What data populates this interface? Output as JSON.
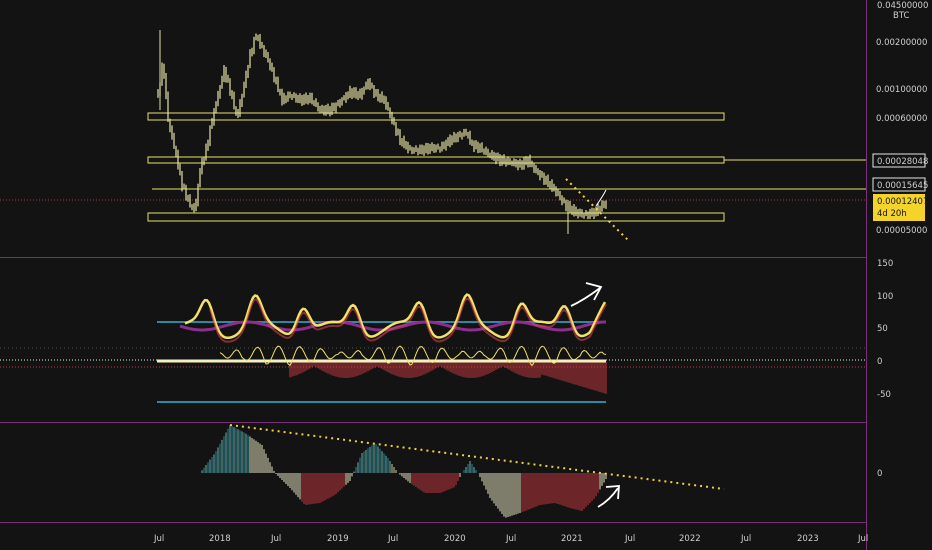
{
  "colors": {
    "background": "#131313",
    "separator": "#7b2f7a",
    "zone_line": "#e8e06a",
    "candle": "#e6e3a6",
    "trend": "#f2d23a",
    "teal": "#2a8aa6",
    "purple": "#8a2f8f",
    "yellow_line": "#f2e26a",
    "red_line": "#e2474f",
    "red_hist": "#c43a3f",
    "green_hist": "#3f9f7a",
    "arrow": "#ffffff",
    "price_tag_bg": "#f4d42a",
    "price_tag_text": "#131313",
    "tag_bg": "#131313",
    "tag_text": "#e6e6e6"
  },
  "price_axis": {
    "top_label": "0.04500000",
    "unit": "BTC",
    "ticks": [
      "0.00200000",
      "0.00100000",
      "0.00060000",
      "0.00005000"
    ],
    "tags": [
      "0.00028048",
      "0.00015645"
    ],
    "current": "0.00012407",
    "countdown": "4d 20h"
  },
  "osc_axis": {
    "ticks": [
      "150",
      "100",
      "50",
      "0",
      "-50"
    ]
  },
  "hist_axis": {
    "ticks": [
      "0"
    ]
  },
  "time_axis": {
    "ticks": [
      "Jul",
      "2018",
      "Jul",
      "2019",
      "Jul",
      "2020",
      "Jul",
      "2021",
      "Jul",
      "2022",
      "Jul",
      "2023",
      "Jul"
    ]
  }
}
